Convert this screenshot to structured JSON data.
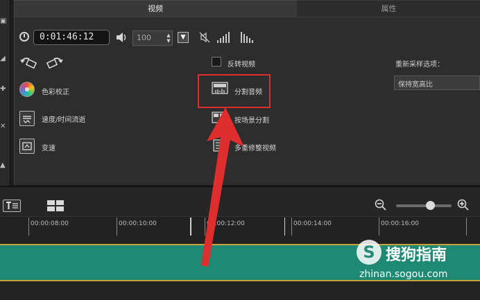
{
  "tabs": {
    "video": "视频",
    "attributes": "属性"
  },
  "timecode": "0:01:46:12",
  "volume": {
    "value": "100"
  },
  "options": {
    "color_correction": "色彩校正",
    "speed_time_flow": "速度/时间流逝",
    "variable_speed": "变速",
    "reverse_video": "反转视频",
    "split_audio": "分割音频",
    "split_by_scene": "按场景分割",
    "multi_trim_video": "多重修整视频"
  },
  "reverse_video_checked": false,
  "resample": {
    "label": "重新采样选项：",
    "value": "保持宽高比"
  },
  "ruler": {
    "labels": [
      "00:00:08:00",
      "00:00:10:00",
      "00:00:12:00",
      "00:00:14:00",
      "00:00:16:00"
    ]
  },
  "watermark": {
    "logo": "S",
    "brand": "搜狗指南",
    "url": "zhinan.sogou.com"
  },
  "colors": {
    "highlight": "#e02d2d",
    "track": "#1f8a73",
    "arrow": "#e02d2d"
  },
  "icons": [
    "clock-icon",
    "speaker-icon",
    "mute-icon",
    "fade-in-icon",
    "fade-out-icon",
    "rotate-left-icon",
    "rotate-right-icon",
    "color-wheel-icon",
    "speed-icon",
    "variable-speed-icon",
    "split-audio-icon",
    "scene-split-icon",
    "multi-trim-icon",
    "title-track-icon",
    "storyboard-icon",
    "zoom-out-icon",
    "zoom-in-icon"
  ]
}
